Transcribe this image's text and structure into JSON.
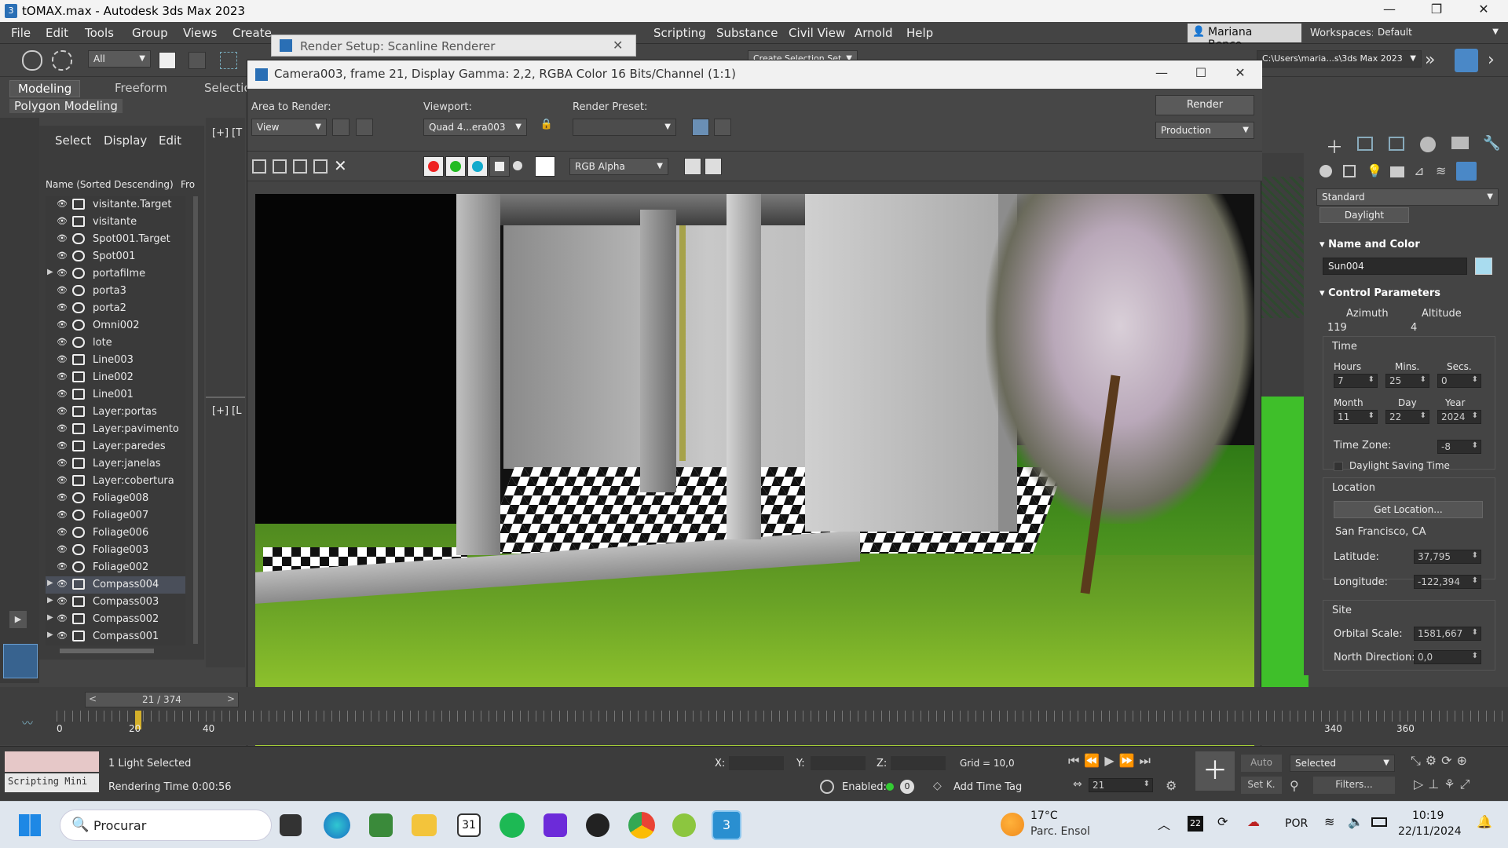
{
  "app": {
    "title": "tOMAX.max - Autodesk 3ds Max 2023",
    "window_controls": [
      "—",
      "❐",
      "✕"
    ]
  },
  "menu": {
    "items": [
      "File",
      "Edit",
      "Tools",
      "Group",
      "Views",
      "Create",
      "Scripting",
      "Substance",
      "Civil View",
      "Arnold",
      "Help"
    ],
    "user": "Mariana Benco...",
    "workspaces_label": "Workspaces:",
    "workspace_value": "Default"
  },
  "toolbar": {
    "filter_value": "All",
    "selection_set_placeholder": "Create Selection Set",
    "path": "C:\\Users\\maria...s\\3ds Max 2023"
  },
  "ribbon": {
    "tabs": [
      "Modeling",
      "Freeform",
      "Selection"
    ],
    "active_tab": "Modeling",
    "sub_label": "Polygon Modeling"
  },
  "scene_explorer": {
    "tabs": [
      "Select",
      "Display",
      "Edit"
    ],
    "column_header": "Name (Sorted Descending)",
    "column_header2": "Fro",
    "rows": [
      {
        "name": "visitante.Target",
        "type": "camera",
        "expand": false
      },
      {
        "name": "visitante",
        "type": "camera",
        "expand": false
      },
      {
        "name": "Spot001.Target",
        "type": "light",
        "expand": false
      },
      {
        "name": "Spot001",
        "type": "light",
        "expand": false
      },
      {
        "name": "portafilme",
        "type": "geo",
        "expand": true
      },
      {
        "name": "porta3",
        "type": "geo",
        "expand": false
      },
      {
        "name": "porta2",
        "type": "geo",
        "expand": false
      },
      {
        "name": "Omni002",
        "type": "light",
        "expand": false
      },
      {
        "name": "lote",
        "type": "geo",
        "expand": false
      },
      {
        "name": "Line003",
        "type": "shape",
        "expand": false
      },
      {
        "name": "Line002",
        "type": "shape",
        "expand": false
      },
      {
        "name": "Line001",
        "type": "shape",
        "expand": false
      },
      {
        "name": "Layer:portas",
        "type": "layer",
        "expand": false
      },
      {
        "name": "Layer:pavimento",
        "type": "layer",
        "expand": false
      },
      {
        "name": "Layer:paredes",
        "type": "layer",
        "expand": false
      },
      {
        "name": "Layer:janelas",
        "type": "layer",
        "expand": false
      },
      {
        "name": "Layer:cobertura",
        "type": "layer",
        "expand": false
      },
      {
        "name": "Foliage008",
        "type": "geo",
        "expand": false
      },
      {
        "name": "Foliage007",
        "type": "geo",
        "expand": false
      },
      {
        "name": "Foliage006",
        "type": "geo",
        "expand": false
      },
      {
        "name": "Foliage003",
        "type": "geo",
        "expand": false
      },
      {
        "name": "Foliage002",
        "type": "geo",
        "expand": false
      },
      {
        "name": "Compass004",
        "type": "helper",
        "expand": true,
        "selected": true
      },
      {
        "name": "Compass003",
        "type": "helper",
        "expand": true
      },
      {
        "name": "Compass002",
        "type": "helper",
        "expand": true
      },
      {
        "name": "Compass001",
        "type": "helper",
        "expand": true
      }
    ]
  },
  "viewport_labels": [
    "[+] [T",
    "[+] [L"
  ],
  "render_setup": {
    "title": "Render Setup: Scanline Renderer"
  },
  "frame_window": {
    "title": "Camera003, frame 21, Display Gamma: 2,2, RGBA Color 16 Bits/Channel (1:1)",
    "area_to_render_label": "Area to Render:",
    "area_to_render_value": "View",
    "viewport_label": "Viewport:",
    "viewport_value": "Quad 4...era003",
    "render_preset_label": "Render Preset:",
    "render_preset_value": "",
    "render_button": "Render",
    "production_value": "Production",
    "channel_value": "RGB Alpha"
  },
  "command_panel": {
    "category": "Standard",
    "object_type": "Daylight",
    "name_and_color_header": "Name and Color",
    "object_name": "Sun004",
    "control_params_header": "Control Parameters",
    "azimuth_label": "Azimuth",
    "azimuth": "119",
    "altitude_label": "Altitude",
    "altitude": "4",
    "time_group": "Time",
    "hours_label": "Hours",
    "hours": "7",
    "mins_label": "Mins.",
    "mins": "25",
    "secs_label": "Secs.",
    "secs": "0",
    "month_label": "Month",
    "month": "11",
    "day_label": "Day",
    "day": "22",
    "year_label": "Year",
    "year": "2024",
    "timezone_label": "Time Zone:",
    "timezone": "-8",
    "dst_label": "Daylight Saving Time",
    "location_group": "Location",
    "get_location_button": "Get Location...",
    "location": "San Francisco, CA",
    "latitude_label": "Latitude:",
    "latitude": "37,795",
    "longitude_label": "Longitude:",
    "longitude": "-122,394",
    "site_group": "Site",
    "orbital_scale_label": "Orbital Scale:",
    "orbital_scale": "1581,667",
    "north_dir_label": "North Direction:",
    "north_dir": "0,0",
    "accent_color": "#a9dcef"
  },
  "timeline": {
    "frame_counter": "21 / 374",
    "ticks_left": [
      "0",
      "20",
      "40"
    ],
    "ticks_right": [
      "340",
      "360"
    ]
  },
  "status": {
    "script_label": "Scripting Mini",
    "selection": "1 Light Selected",
    "render_time": "Rendering Time 0:00:56",
    "x_label": "X:",
    "y_label": "Y:",
    "z_label": "Z:",
    "grid": "Grid = 10,0",
    "enabled_label": "Enabled:",
    "add_time_tag": "Add Time Tag",
    "auto_label": "Auto",
    "setk_label": "Set K.",
    "selected_value": "Selected",
    "filters_button": "Filters...",
    "current_frame": "21"
  },
  "taskbar": {
    "search_placeholder": "Procurar",
    "weather_temp": "17°C",
    "weather_desc": "Parc. Ensol",
    "language": "POR",
    "time": "10:19",
    "date": "22/11/2024",
    "calendar_day": "31",
    "notif_count": "22"
  }
}
